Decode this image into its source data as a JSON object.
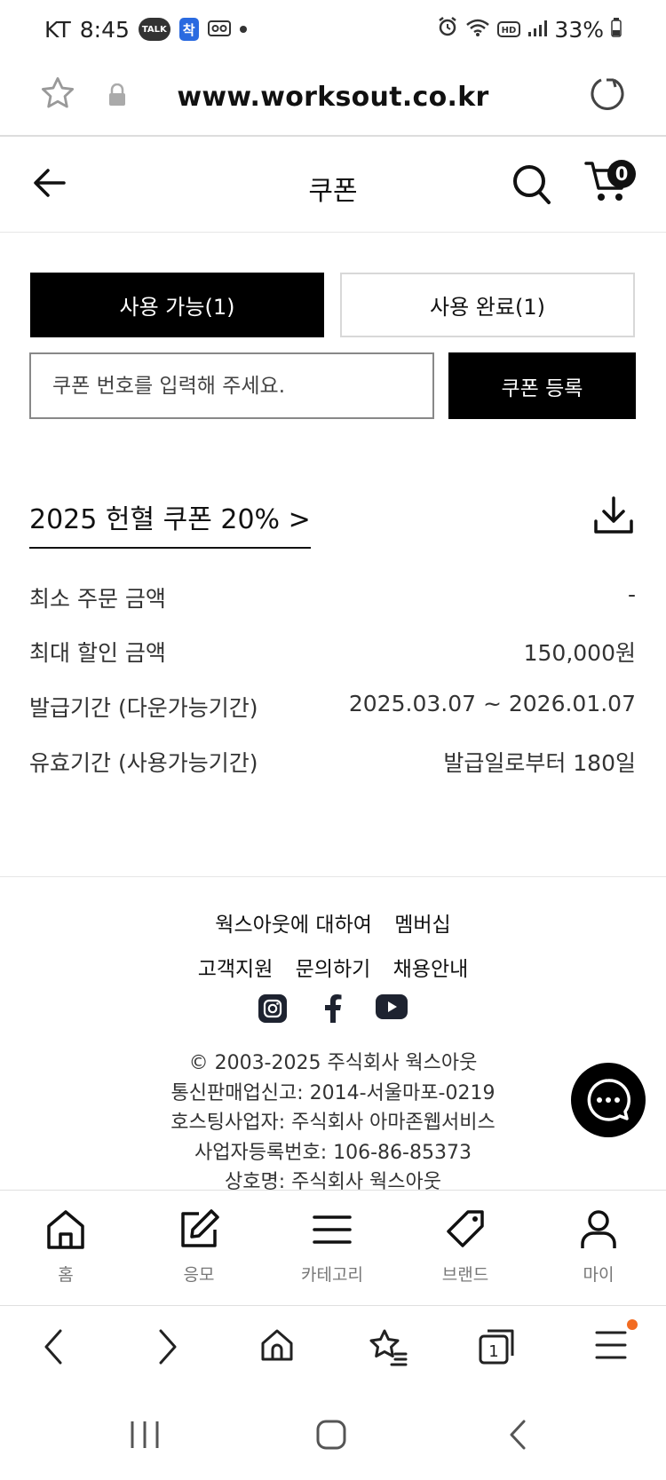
{
  "status_bar": {
    "carrier": "KT",
    "time": "8:45",
    "talk_badge": "TALK",
    "app_badge": "착",
    "battery": "33%"
  },
  "browser": {
    "url": "www.worksout.co.kr"
  },
  "header": {
    "title": "쿠폰",
    "cart_count": "0"
  },
  "tabs": [
    {
      "label": "사용 가능(1)",
      "active": true
    },
    {
      "label": "사용 완료(1)",
      "active": false
    }
  ],
  "coupon_form": {
    "placeholder": "쿠폰 번호를 입력해 주세요.",
    "register_label": "쿠폰 등록"
  },
  "coupon": {
    "name": "2025 헌혈 쿠폰 20% >",
    "details": [
      {
        "label": "최소 주문 금액",
        "value": "-"
      },
      {
        "label": "최대 할인 금액",
        "value": "150,000원"
      },
      {
        "label": "발급기간 (다운가능기간)",
        "value": "2025.03.07 ~ 2026.01.07"
      },
      {
        "label": "유효기간 (사용가능기간)",
        "value": "발급일로부터 180일"
      }
    ]
  },
  "footer": {
    "links_row1": [
      "웍스아웃에 대하여",
      "멤버십"
    ],
    "links_row2": [
      "고객지원",
      "문의하기",
      "채용안내"
    ],
    "social": [
      "instagram-icon",
      "facebook-icon",
      "youtube-icon"
    ],
    "info": [
      "© 2003-2025 주식회사 웍스아웃",
      "통신판매업신고: 2014-서울마포-0219",
      "호스팅사업자: 주식회사 아마존웹서비스",
      "사업자등록번호: 106-86-85373",
      "상호명: 주식회사 웍스아웃"
    ]
  },
  "bottom_nav": [
    {
      "label": "홈",
      "icon": "home-icon"
    },
    {
      "label": "응모",
      "icon": "edit-icon"
    },
    {
      "label": "카테고리",
      "icon": "menu-icon"
    },
    {
      "label": "브랜드",
      "icon": "tag-icon"
    },
    {
      "label": "마이",
      "icon": "user-icon"
    }
  ],
  "browser_nav": {
    "tab_count": "1"
  },
  "colors": {
    "primary": "#000000",
    "notification_dot": "#f26b21"
  }
}
